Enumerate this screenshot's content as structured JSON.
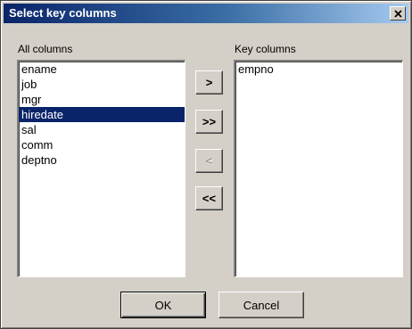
{
  "window": {
    "title": "Select key columns",
    "close_icon": "close-icon"
  },
  "all_columns": {
    "label": "All columns",
    "items": [
      "ename",
      "job",
      "mgr",
      "hiredate",
      "sal",
      "comm",
      "deptno"
    ],
    "selected": "hiredate"
  },
  "key_columns": {
    "label": "Key columns",
    "items": [
      "empno"
    ]
  },
  "move_buttons": {
    "add_one": ">",
    "add_all": ">>",
    "remove_one": "<",
    "remove_all": "<<"
  },
  "footer": {
    "ok_label": "OK",
    "cancel_label": "Cancel"
  },
  "colors": {
    "title_gradient_start": "#0a246a",
    "title_gradient_end": "#a6caf0",
    "selection": "#0a246a",
    "dialog_face": "#d4d0c8"
  }
}
